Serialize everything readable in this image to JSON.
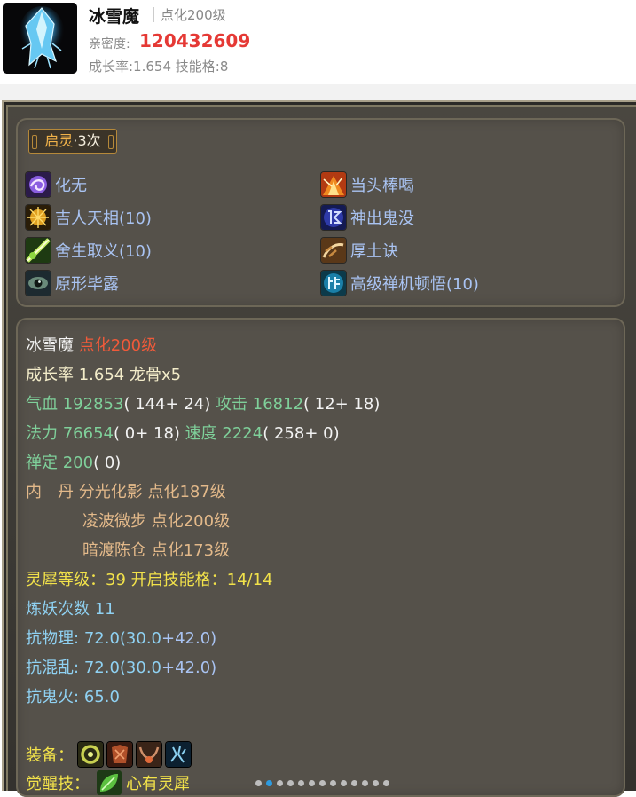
{
  "header": {
    "pet_name": "冰雪魔",
    "level": "点化200级",
    "intimacy_label": "亲密度:",
    "intimacy_value": "120432609",
    "growth_line": "成长率:1.654 技能格:8",
    "avatar_icon": "ice-crystal-icon"
  },
  "awaken": {
    "label": "启灵",
    "count": "·3次"
  },
  "skills": [
    {
      "name": "化无",
      "icon": "swirl-icon"
    },
    {
      "name": "当头棒喝",
      "icon": "flame-burst-icon"
    },
    {
      "name": "吉人天相(10)",
      "icon": "golden-aura-icon"
    },
    {
      "name": "神出鬼没",
      "icon": "hidden-rune-icon"
    },
    {
      "name": "舍生取义(10)",
      "icon": "green-beam-icon"
    },
    {
      "name": "厚土诀",
      "icon": "earth-claw-icon"
    },
    {
      "name": "原形毕露",
      "icon": "eye-icon"
    },
    {
      "name": "高级禅机顿悟(10)",
      "icon": "zen-rune-icon"
    }
  ],
  "stats": {
    "name": "冰雪魔",
    "level": "点化200级",
    "growth": "成长率 1.654 龙骨x5",
    "hp_label": "气血",
    "hp_value": "192853",
    "hp_extra": "( 144+ 24)",
    "attack_label": "攻击",
    "attack_value": "16812",
    "attack_extra": "( 12+ 18)",
    "mana_label": "法力",
    "mana_value": "76654",
    "mana_extra": "( 0+ 18)",
    "speed_label": "速度",
    "speed_value": "2224",
    "speed_extra": "( 258+ 0)",
    "zen_label": "禅定",
    "zen_value": "200",
    "zen_extra": "( 0)",
    "neidan": [
      "内　丹 分光化影 点化187级",
      "凌波微步 点化200级",
      "暗渡陈仓 点化173级"
    ],
    "lingxi": "灵犀等级：39 开启技能格：14/14",
    "lianyao": "炼妖次数 11",
    "resist_physical_label": "抗物理:",
    "resist_physical_value": "72.0(30.0",
    "resist_physical_bonus": "+42.0)",
    "resist_chaos_label": "抗混乱:",
    "resist_chaos_value": "72.0(30.0",
    "resist_chaos_bonus": "+42.0)",
    "resist_ghostfire_label": "抗鬼火:",
    "resist_ghostfire_value": "65.0"
  },
  "equipment": {
    "label": "装备：",
    "items": [
      "equip-ring-icon",
      "equip-armor-icon",
      "equip-necklace-icon",
      "equip-gem-icon"
    ]
  },
  "awakened_skill": {
    "label": "觉醒技：",
    "name": "心有灵犀",
    "icon": "leaf-icon"
  },
  "pager": {
    "total": 13,
    "active_index": 1
  },
  "colors": {
    "panel_bg": "#3d3b36",
    "card_bg": "#55514a",
    "accent_red": "#e53935",
    "skill_blue": "#a9c3f2",
    "stat_green": "#7fd09a",
    "pager_active": "#2d9be0"
  }
}
